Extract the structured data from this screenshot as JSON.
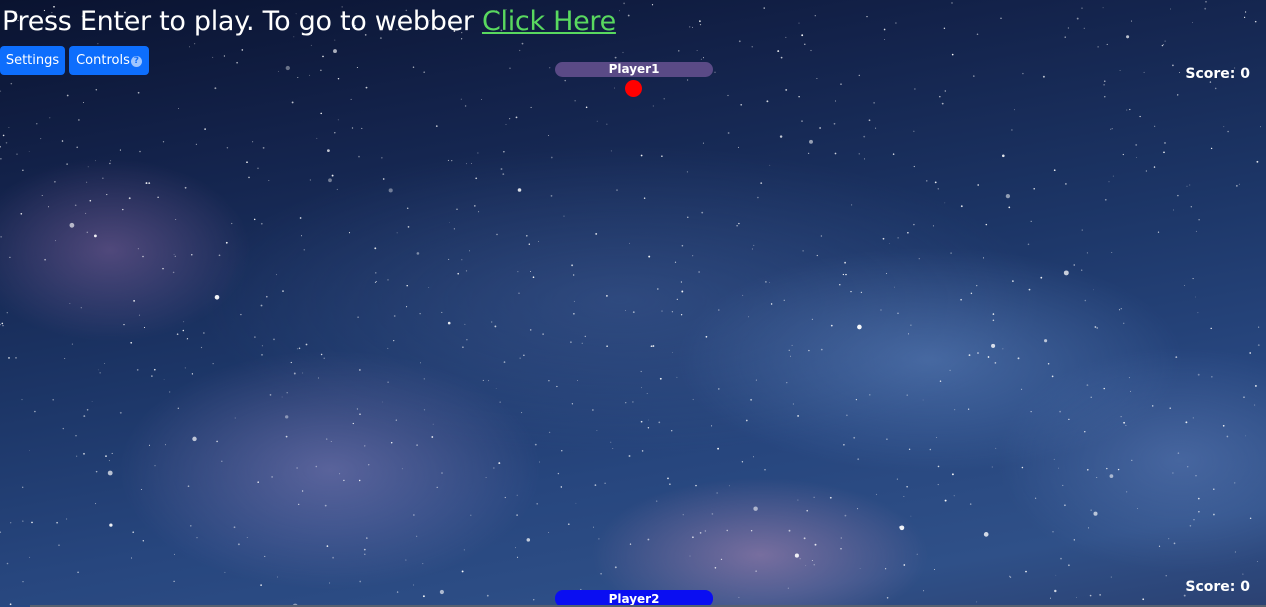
{
  "header": {
    "prompt_text": "Press Enter to play. To go to webber ",
    "link_text": "Click Here"
  },
  "toolbar": {
    "settings_label": "Settings",
    "controls_label": "Controls",
    "controls_help_glyph": "?"
  },
  "game": {
    "player1": {
      "name": "Player1",
      "score_label": "Score: 0",
      "color": "#5a4a86"
    },
    "player2": {
      "name": "Player2",
      "score_label": "Score: 0",
      "color": "#0a0ef2"
    },
    "ball": {
      "color": "#ff0000"
    }
  },
  "colors": {
    "link": "#59d85f",
    "button": "#0d6efd",
    "text": "#ffffff"
  }
}
